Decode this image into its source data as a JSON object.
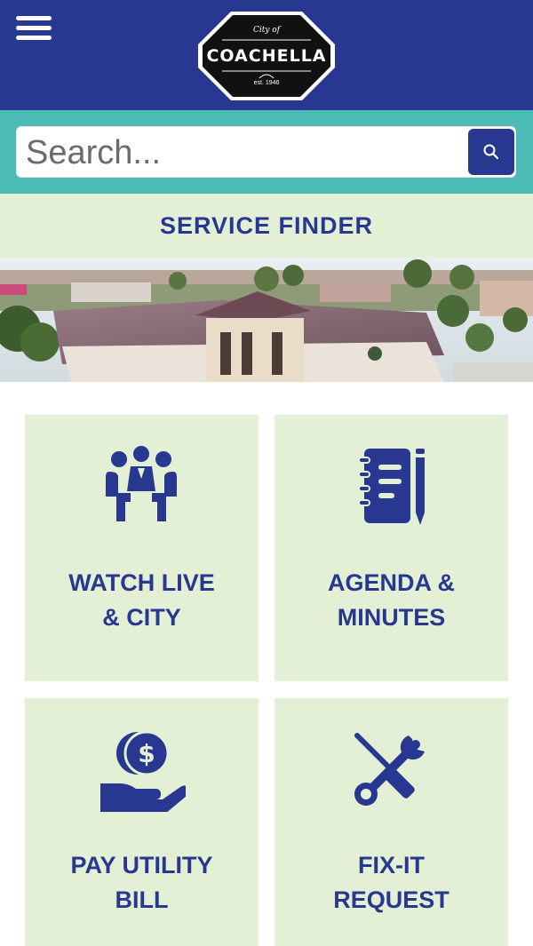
{
  "header": {
    "menu_icon": "hamburger-menu-icon",
    "logo": {
      "top_text": "City of",
      "name": "COACHELLA",
      "est_text": "est. 1946"
    }
  },
  "search": {
    "placeholder": "Search...",
    "button_icon": "search-icon"
  },
  "service_finder": {
    "label": "SERVICE FINDER"
  },
  "hero": {
    "image": "aerial photo of Coachella city hall building"
  },
  "tiles": [
    {
      "line1": "WATCH LIVE",
      "line2": "& CITY",
      "icon": "meeting-people-icon"
    },
    {
      "line1": "AGENDA &",
      "line2": "MINUTES",
      "icon": "notebook-pen-icon"
    },
    {
      "line1": "PAY UTILITY",
      "line2": "BILL",
      "icon": "hand-coin-dollar-icon"
    },
    {
      "line1": "FIX-IT",
      "line2": "REQUEST",
      "icon": "wrench-screwdriver-icon"
    }
  ],
  "colors": {
    "header_bg": "#283891",
    "search_band_bg": "#4cbab5",
    "tile_bg": "#e4f0d5",
    "accent_text": "#283891"
  }
}
